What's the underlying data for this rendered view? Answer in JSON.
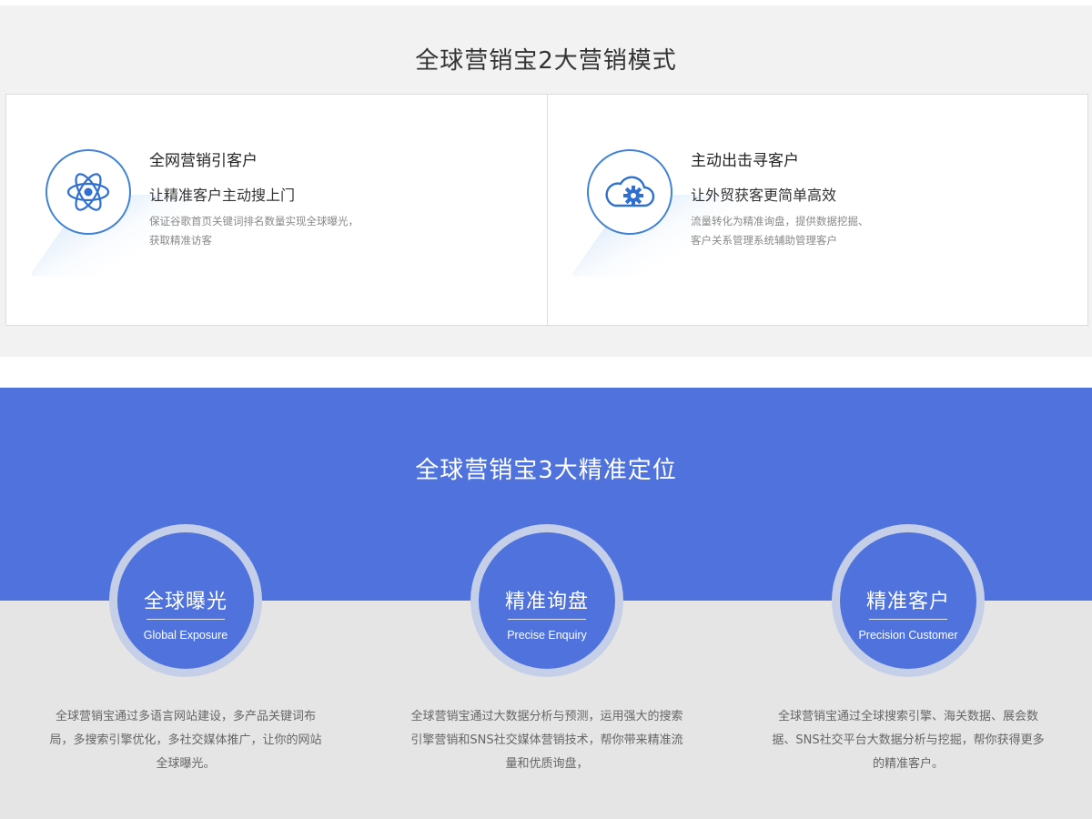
{
  "section_modes": {
    "title": "全球营销宝2大营销模式",
    "modes": [
      {
        "icon": "atom-icon",
        "title": "全网营销引客户",
        "subtitle": "让精准客户主动搜上门",
        "desc_line1": "保证谷歌首页关键词排名数量实现全球曝光，",
        "desc_line2": "获取精准访客"
      },
      {
        "icon": "cloud-gear-icon",
        "title": "主动出击寻客户",
        "subtitle": "让外贸获客更简单高效",
        "desc_line1": "流量转化为精准询盘，提供数据挖掘、",
        "desc_line2": "客户关系管理系统辅助管理客户"
      }
    ]
  },
  "section_positioning": {
    "title": "全球营销宝3大精准定位",
    "items": [
      {
        "title_cn": "全球曝光",
        "title_en": "Global Exposure",
        "desc_line1": "全球营销宝通过多语言网站建设，多产品关键词布",
        "desc_line2": "局，多搜索引擎优化，多社交媒体推广，让你的网站",
        "desc_line3": "全球曝光。"
      },
      {
        "title_cn": "精准询盘",
        "title_en": "Precise Enquiry",
        "desc_line1": "全球营销宝通过大数据分析与预测，运用强大的搜索",
        "desc_line2": "引擎营销和SNS社交媒体营销技术，帮你带来精准流",
        "desc_line3": "量和优质询盘，"
      },
      {
        "title_cn": "精准客户",
        "title_en": "Precision Customer",
        "desc_line1": "全球营销宝通过全球搜索引擎、海关数据、展会数",
        "desc_line2": "据、SNS社交平台大数据分析与挖掘，帮你获得更多",
        "desc_line3": "的精准客户。"
      }
    ]
  },
  "colors": {
    "accent_blue": "#4f72dd",
    "icon_blue": "#3f82d8",
    "panel_bg": "#f2f2f2",
    "bottom_bg": "#e5e5e5"
  }
}
